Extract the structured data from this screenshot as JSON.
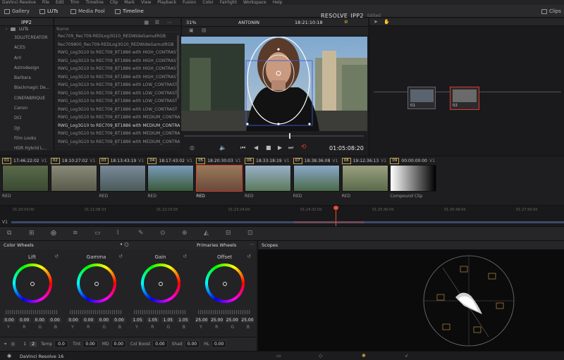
{
  "menubar": [
    "DaVinci Resolve",
    "File",
    "Edit",
    "Trim",
    "Timeline",
    "Clip",
    "Mark",
    "View",
    "Playback",
    "Fusion",
    "Color",
    "Fairlight",
    "Workspace",
    "Help"
  ],
  "toolbar": {
    "gallery": "Gallery",
    "luts": "LUTs",
    "media_pool": "Media Pool",
    "timeline": "Timeline",
    "project": "RESOLVE_IPP2",
    "edited": "Edited",
    "clips": "Clips"
  },
  "lut_browser": {
    "folder": "IPP2",
    "tree_root": "LUTs",
    "tree": [
      "3DLUTCREATOR",
      "ACES",
      "Arri",
      "Astrodesign",
      "Barbara",
      "Blackmagic De...",
      "CINEFABRIQUE",
      "Canon",
      "DCI",
      "DJI",
      "Film Looks",
      "HDR Hybrid L..."
    ],
    "col_name": "Name",
    "rows": [
      "Rec709_Rec709-REDLog3G10_REDWideGamutRGB",
      "Rec709800_Rec709-REDLog3G10_REDWideGamutRGB",
      "RWG_Log3G10 to REC709_BT1886 with HIGH_CONTRAST",
      "RWG_Log3G10 to REC709_BT1886 with HIGH_CONTRAST",
      "RWG_Log3G10 to REC709_BT1886 with HIGH_CONTRAST",
      "RWG_Log3G10 to REC709_BT1886 with HIGH_CONTRAST",
      "RWG_Log3G10 to REC709_BT1886 with LOW_CONTRAST",
      "RWG_Log3G10 to REC709_BT1886 with LOW_CONTRAST",
      "RWG_Log3G10 to REC709_BT1886 with LOW_CONTRAST",
      "RWG_Log3G10 to REC709_BT1886 with LOW_CONTRAST",
      "RWG_Log3G10 to REC709_BT1886 with MEDIUM_CONTRA",
      "RWG_Log3G10 to REC709_BT1886 with MEDIUM_CONTRA",
      "RWG_Log3G10 to REC709_BT1886 with MEDIUM_CONTRA",
      "RWG_Log3G10 to REC709_BT1886 with MEDIUM_CONTRA"
    ],
    "selected_row": 11
  },
  "viewer": {
    "zoom": "31%",
    "clip_name": "ANTONIN",
    "timecode_top": "18:21:10:18",
    "timecode": "01:05:08:20"
  },
  "nodes": [
    {
      "label": "01"
    },
    {
      "label": "02"
    }
  ],
  "clips": [
    {
      "num": "01",
      "tc": "17:46:22:02",
      "track": "V1",
      "label": "RED"
    },
    {
      "num": "02",
      "tc": "18:10:27:02",
      "track": "V1",
      "label": ""
    },
    {
      "num": "03",
      "tc": "18:13:43:19",
      "track": "V1",
      "label": "RED"
    },
    {
      "num": "04",
      "tc": "18:17:43:02",
      "track": "V1",
      "label": "RED"
    },
    {
      "num": "05",
      "tc": "18:20:30:03",
      "track": "V1",
      "label": "RED"
    },
    {
      "num": "06",
      "tc": "18:33:18:19",
      "track": "V1",
      "label": "RED"
    },
    {
      "num": "07",
      "tc": "18:38:36:08",
      "track": "V1",
      "label": "RED"
    },
    {
      "num": "08",
      "tc": "19:12:36:13",
      "track": "V1",
      "label": "RED"
    },
    {
      "num": "09",
      "tc": "00:00:00:00",
      "track": "V1",
      "label": "Compound Clip"
    }
  ],
  "timeline": {
    "track": "V1",
    "ticks": [
      "01:20:03:00",
      "01:21:08:33",
      "01:22:15:05",
      "01:23:24:00",
      "01:24:32:00",
      "01:25:40:00",
      "01:26:48:00",
      "01:27:56:00"
    ]
  },
  "color_wheels": {
    "title": "Color Wheels",
    "mode": "Primaries Wheels",
    "wheels": [
      {
        "name": "Lift",
        "values": [
          "0.00",
          "0.00",
          "0.00",
          "0.00"
        ]
      },
      {
        "name": "Gamma",
        "values": [
          "0.00",
          "0.00",
          "0.00",
          "0.00"
        ]
      },
      {
        "name": "Gain",
        "values": [
          "1.05",
          "1.05",
          "1.05",
          "1.05"
        ]
      },
      {
        "name": "Offset",
        "values": [
          "25.00",
          "25.00",
          "25.00",
          "25.00"
        ]
      }
    ],
    "channels": [
      "Y",
      "R",
      "G",
      "B"
    ]
  },
  "bottom": {
    "page1": "1",
    "page2": "2",
    "temp_label": "Temp",
    "temp": "0.0",
    "tint_label": "Tint",
    "tint": "0.00",
    "md_label": "MD",
    "md": "0.00",
    "boost_label": "Col Boost",
    "boost": "0.00",
    "shad_label": "Shad",
    "shad": "0.00",
    "hl_label": "HL",
    "hl": "0.00"
  },
  "scopes": {
    "title": "Scopes"
  },
  "status": {
    "app": "DaVinci Resolve 16"
  },
  "colors": {
    "accent": "#e0392b",
    "playhead": "#e8502e",
    "selected_clip": "#d33a2c"
  }
}
